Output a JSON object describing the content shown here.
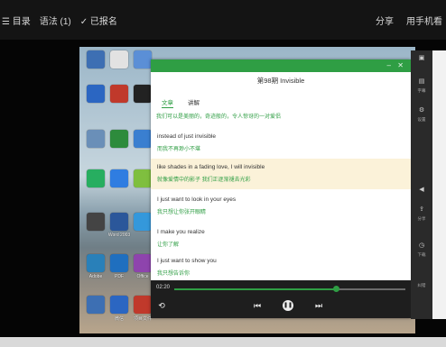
{
  "topbar": {
    "menu_label": "目录",
    "notes_label": "语法 (1)",
    "registered_label": "已报名",
    "share_label": "分享",
    "phone_label": "用手机看"
  },
  "lesson": {
    "title": "第98期 Invisible",
    "tabs": [
      {
        "label": "文章"
      },
      {
        "label": "讲解"
      }
    ],
    "summary": "我们可以是美丽的，奇迹般的，令人惊讶的一对爱侣",
    "lines": [
      {
        "en": "instead of just invisible",
        "zh": "而我不再渺小不堪"
      },
      {
        "en": "like shades in a fading love, I will invisible",
        "zh": "就像爱情中的影子 我们正逐渐褪去光彩"
      },
      {
        "en": "I just want to look in your eyes",
        "zh": "我只想让你张开眼睛"
      },
      {
        "en": "I make you realize",
        "zh": "让你了解"
      },
      {
        "en": "I just want to show you",
        "zh": "我只想告诉你"
      }
    ]
  },
  "player": {
    "current_time": "02:20",
    "progress": 0.7
  },
  "desktop": {
    "labels": [
      "Word 2003",
      "Adobe",
      "PDF",
      "Office",
      "微信",
      "项目文件"
    ]
  },
  "sidebar": {
    "labels": [
      "字幕",
      "设置",
      "分享",
      "下载",
      "纠错"
    ]
  },
  "colors": {
    "accent": "#2f9e44",
    "highlight": "#fbf2d9",
    "player_bg": "#1e1e1e"
  }
}
